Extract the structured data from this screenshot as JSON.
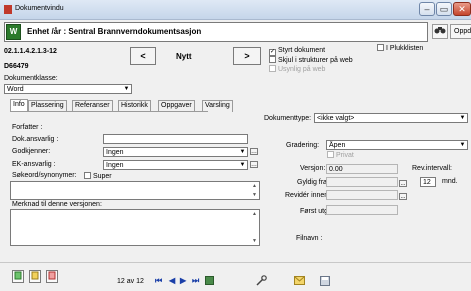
{
  "window": {
    "title": "Dokumentvindu",
    "minimize": "–",
    "maximize": "▭",
    "close": "✕"
  },
  "header": {
    "title": "Enhet /år : Sentral Brannverndokumentsasjon",
    "update_label": "Oppdater"
  },
  "document": {
    "number": "02.1.1.4.2.1.3-12",
    "id": "D66479",
    "class_label": "Dokumentklasse:",
    "class_value": "Word",
    "nav_prev": "<",
    "nav_status": "Nytt",
    "nav_next": ">"
  },
  "options": {
    "styrt": {
      "label": "Styrt dokument",
      "checked": true
    },
    "skjult": {
      "label": "Skjul i strukturer på web",
      "checked": false
    },
    "usynlig": {
      "label": "Usynlig på web",
      "checked": false
    },
    "plukklisten": {
      "label": "I Plukklisten",
      "checked": false
    }
  },
  "tabs": [
    "Info",
    "Plassering",
    "Referanser",
    "Historikk",
    "Oppgaver",
    "Varsling"
  ],
  "info": {
    "forfatter_label": "Forfatter :",
    "forfatter_value": "",
    "dok_ansvarlig_label": "Dok.ansvarlig :",
    "dok_ansvarlig_value": "",
    "godkjenner_label": "Godkjenner:",
    "godkjenner_value": "Ingen",
    "ek_ansvarlig_label": "EK-ansvarlig :",
    "ek_ansvarlig_value": "Ingen",
    "sokeord_label": "Søkeord/synonymer:",
    "super_label": "Super",
    "merknad_label": "Merknad til denne versjonen:"
  },
  "right": {
    "dokumenttype_label": "Dokumenttype:",
    "dokumenttype_value": "<ikke valgt>",
    "gradering_label": "Gradering:",
    "gradering_value": "Åpen",
    "privat_label": "Privat",
    "versjon_label": "Versjon:",
    "versjon_value": "0.00",
    "rev_intervall_label": "Rev.intervall:",
    "rev_intervall_value": "12",
    "rev_unit": "mnd.",
    "gyldig_label": "Gyldig fra:",
    "revider_label": "Revidér innen:",
    "forst_utgitt_label": "Først utgitt:",
    "filnavn_label": "Filnavn :",
    "browse": "..."
  },
  "footer": {
    "record_text": "12 av 12",
    "nav_first": "⏮",
    "nav_prev": "◀",
    "nav_next": "▶",
    "nav_last": "⏭"
  },
  "icons": [
    "new-doc-icon",
    "edit-doc-icon",
    "delete-doc-icon",
    "tools-icon",
    "mail-icon",
    "save-icon",
    "binoculars-icon"
  ]
}
